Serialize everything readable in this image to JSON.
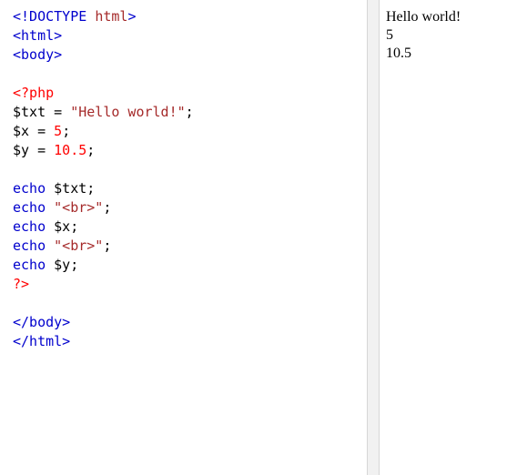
{
  "editor": {
    "lines": [
      [
        {
          "t": "<!DOCTYPE ",
          "c": "blue"
        },
        {
          "t": "html",
          "c": "brown"
        },
        {
          "t": ">",
          "c": "blue"
        }
      ],
      [
        {
          "t": "<html>",
          "c": "blue"
        }
      ],
      [
        {
          "t": "<body>",
          "c": "blue"
        }
      ],
      [],
      [
        {
          "t": "<?php",
          "c": "red"
        }
      ],
      [
        {
          "t": "$txt = ",
          "c": "black"
        },
        {
          "t": "\"Hello world!\"",
          "c": "brown"
        },
        {
          "t": ";",
          "c": "black"
        }
      ],
      [
        {
          "t": "$x = ",
          "c": "black"
        },
        {
          "t": "5",
          "c": "red"
        },
        {
          "t": ";",
          "c": "black"
        }
      ],
      [
        {
          "t": "$y = ",
          "c": "black"
        },
        {
          "t": "10.5",
          "c": "red"
        },
        {
          "t": ";",
          "c": "black"
        }
      ],
      [],
      [
        {
          "t": "echo ",
          "c": "blue"
        },
        {
          "t": "$txt;",
          "c": "black"
        }
      ],
      [
        {
          "t": "echo ",
          "c": "blue"
        },
        {
          "t": "\"<br>\"",
          "c": "brown"
        },
        {
          "t": ";",
          "c": "black"
        }
      ],
      [
        {
          "t": "echo ",
          "c": "blue"
        },
        {
          "t": "$x;",
          "c": "black"
        }
      ],
      [
        {
          "t": "echo ",
          "c": "blue"
        },
        {
          "t": "\"<br>\"",
          "c": "brown"
        },
        {
          "t": ";",
          "c": "black"
        }
      ],
      [
        {
          "t": "echo ",
          "c": "blue"
        },
        {
          "t": "$y;",
          "c": "black"
        }
      ],
      [
        {
          "t": "?>",
          "c": "red"
        }
      ],
      [],
      [
        {
          "t": "</body>",
          "c": "blue"
        }
      ],
      [
        {
          "t": "</html>",
          "c": "blue"
        }
      ]
    ]
  },
  "output": {
    "lines": [
      "Hello world!",
      "5",
      "10.5"
    ]
  },
  "colors": {
    "tag": "#0000cd",
    "attribute": "#a52a2a",
    "php_delim": "#ff0000",
    "number": "#ff0000",
    "string": "#a52a2a",
    "divider": "#f1f1f1"
  }
}
